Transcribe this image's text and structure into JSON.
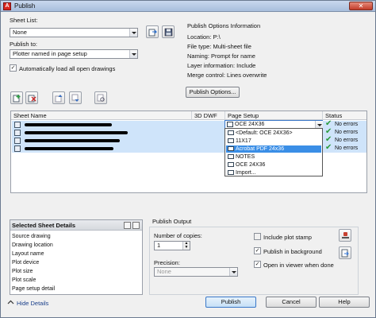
{
  "window": {
    "title": "Publish",
    "close_glyph": "✕"
  },
  "sheet_list": {
    "label": "Sheet List:",
    "value": "None"
  },
  "publish_to": {
    "label": "Publish to:",
    "value": "Plotter named in page setup"
  },
  "auto_load": {
    "label": "Automatically load all open drawings",
    "checked": true
  },
  "info": {
    "heading": "Publish Options Information",
    "lines": [
      "Location: P:\\",
      "File type: Multi-sheet file",
      "Naming: Prompt for name",
      "Layer information: Include",
      "Merge control: Lines overwrite"
    ],
    "button": "Publish Options..."
  },
  "table": {
    "headers": [
      "Sheet Name",
      "3D DWF",
      "Page Setup",
      "Status"
    ],
    "rows": [
      {
        "page_setup": "OCE 24X36",
        "status": "No errors"
      },
      {
        "page_setup": "",
        "status": "No errors"
      },
      {
        "page_setup": "",
        "status": "No errors"
      },
      {
        "page_setup": "",
        "status": "No errors"
      }
    ]
  },
  "page_setup_options": [
    "<Default: OCE 24X36>",
    "11X17",
    "Acrobat PDF 24x36",
    "NOTES",
    "OCE 24X36",
    "Import..."
  ],
  "details": {
    "heading": "Selected Sheet Details",
    "items": [
      "Source drawing",
      "Drawing location",
      "Layout name",
      "Plot device",
      "Plot size",
      "Plot scale",
      "Page setup detail"
    ]
  },
  "output": {
    "heading": "Publish Output",
    "copies_label": "Number of copies:",
    "copies_value": "1",
    "precision_label": "Precision:",
    "precision_value": "None",
    "include_stamp": {
      "label": "Include plot stamp",
      "checked": false
    },
    "background": {
      "label": "Publish in background",
      "checked": true
    },
    "open_viewer": {
      "label": "Open in viewer when done",
      "checked": true
    }
  },
  "footer": {
    "hide_details": "Hide Details",
    "publish": "Publish",
    "cancel": "Cancel",
    "help": "Help"
  },
  "colors": {
    "selected_row": "#cfe4fa",
    "highlight": "#3a8ee6",
    "status_ok": "#2a9a3a"
  }
}
